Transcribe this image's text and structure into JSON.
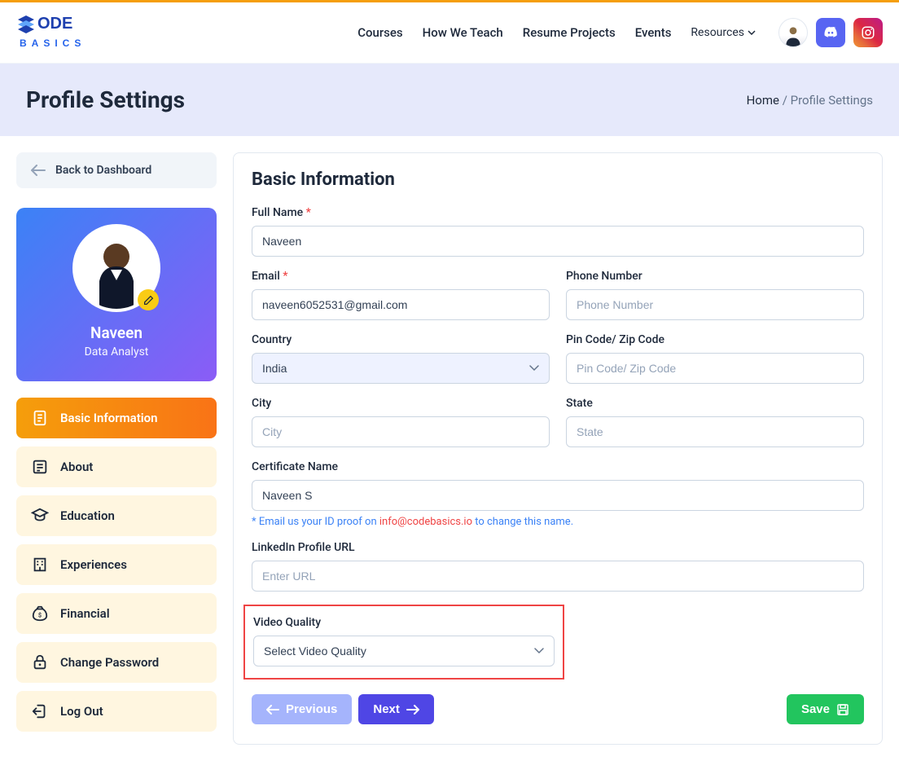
{
  "header": {
    "nav": [
      "Courses",
      "How We Teach",
      "Resume Projects",
      "Events",
      "Resources"
    ],
    "logo_top": "CODE",
    "logo_bottom": "BASICS"
  },
  "breadcrumb": {
    "title": "Profile Settings",
    "home": "Home",
    "current": "Profile Settings"
  },
  "sidebar": {
    "back": "Back to Dashboard",
    "profile_name": "Naveen",
    "profile_role": "Data Analyst",
    "items": [
      {
        "label": "Basic Information",
        "key": "basic-information",
        "active": true
      },
      {
        "label": "About",
        "key": "about"
      },
      {
        "label": "Education",
        "key": "education"
      },
      {
        "label": "Experiences",
        "key": "experiences"
      },
      {
        "label": "Financial",
        "key": "financial"
      },
      {
        "label": "Change Password",
        "key": "change-password"
      },
      {
        "label": "Log Out",
        "key": "log-out"
      }
    ]
  },
  "form": {
    "heading": "Basic Information",
    "labels": {
      "full_name": "Full Name",
      "email": "Email",
      "phone": "Phone Number",
      "country": "Country",
      "pincode": "Pin Code/ Zip Code",
      "city": "City",
      "state": "State",
      "cert": "Certificate Name",
      "linkedin": "LinkedIn Profile URL",
      "video": "Video Quality"
    },
    "values": {
      "full_name": "Naveen",
      "email": "naveen6052531@gmail.com",
      "country": "India",
      "cert": "Naveen S"
    },
    "placeholders": {
      "phone": "Phone Number",
      "pincode": "Pin Code/ Zip Code",
      "city": "City",
      "state": "State",
      "linkedin": "Enter URL",
      "video": "Select Video Quality"
    },
    "hint_pre": "* Email us your ID proof on ",
    "hint_email": "info@codebasics.io",
    "hint_post": " to change this name.",
    "buttons": {
      "prev": "Previous",
      "next": "Next",
      "save": "Save"
    }
  }
}
